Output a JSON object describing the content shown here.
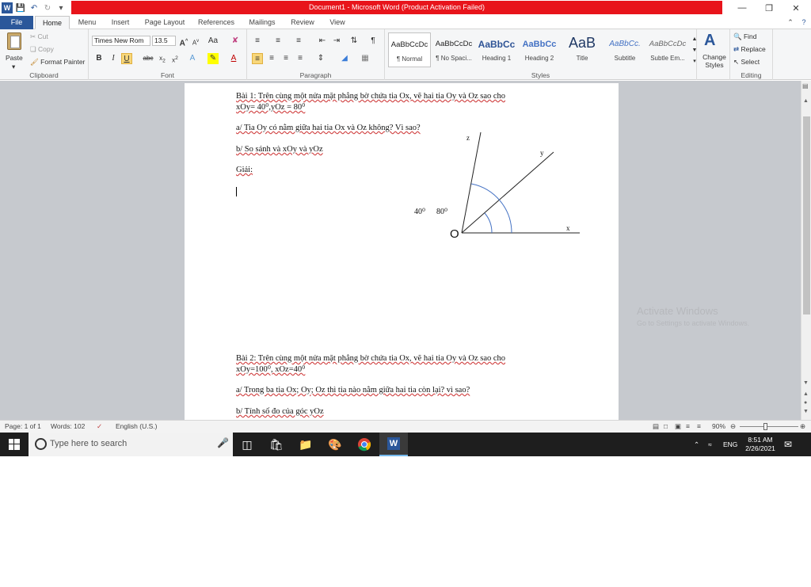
{
  "window": {
    "title": "Document1 - Microsoft Word (Product Activation Failed)"
  },
  "tabs": [
    "File",
    "Home",
    "Menu",
    "Insert",
    "Page Layout",
    "References",
    "Mailings",
    "Review",
    "View"
  ],
  "clipboard": {
    "paste": "Paste",
    "cut": "Cut",
    "copy": "Copy",
    "format_painter": "Format Painter",
    "label": "Clipboard"
  },
  "font": {
    "name": "Times New Rom",
    "size": "13.5",
    "label": "Font"
  },
  "paragraph": {
    "label": "Paragraph"
  },
  "styles": {
    "items": [
      {
        "sample": "AaBbCcDc",
        "name": "¶ Normal"
      },
      {
        "sample": "AaBbCcDc",
        "name": "¶ No Spaci..."
      },
      {
        "sample": "AaBbCc",
        "name": "Heading 1"
      },
      {
        "sample": "AaBbCc",
        "name": "Heading 2"
      },
      {
        "sample": "AaB",
        "name": "Title"
      },
      {
        "sample": "AaBbCc.",
        "name": "Subtitle"
      },
      {
        "sample": "AaBbCcDc",
        "name": "Subtle Em..."
      }
    ],
    "change_styles": "Change Styles",
    "label": "Styles"
  },
  "editing": {
    "find": "Find",
    "replace": "Replace",
    "select": "Select",
    "label": "Editing"
  },
  "document": {
    "p1_line1": "Bài 1: Trên cùng một nửa mặt phẳng bờ chứa tia Ox, vẽ hai tia Oy và Oz sao cho",
    "p1_line2": "xOy= 40⁰,yOz = 80⁰",
    "p1_a": "a/ Tia Oy có nằm giữa hai tia Ox và Oz không? Vì sao?",
    "p1_b": "b/ So sánh và xOy và yOz",
    "p1_giai": "Giải:",
    "fig_label_40": "40⁰",
    "fig_label_80": "80⁰",
    "fig_O": "O",
    "fig_x": "x",
    "fig_y": "y",
    "fig_z": "z",
    "p2_line1": "Bài 2: Trên cùng một nửa mặt phẳng bờ chứa tia Ox, vẽ hai tia Oy và Oz sao cho",
    "p2_line2": "xOy=100⁰, xOz=40⁰",
    "p2_a": "a/ Trong ba tia Ox; Oy; Oz thì tia nào nằm giữa hai tia còn lại? vì sao?",
    "p2_b": "b/ Tính số đo của góc yOz"
  },
  "activate": {
    "line1": "Activate Windows",
    "line2": "Go to Settings to activate Windows."
  },
  "status": {
    "page": "Page: 1 of 1",
    "words": "Words: 102",
    "language": "English (U.S.)",
    "zoom": "90%"
  },
  "taskbar": {
    "search_placeholder": "Type here to search",
    "lang": "ENG",
    "time": "8:51 AM",
    "date": "2/26/2021"
  }
}
